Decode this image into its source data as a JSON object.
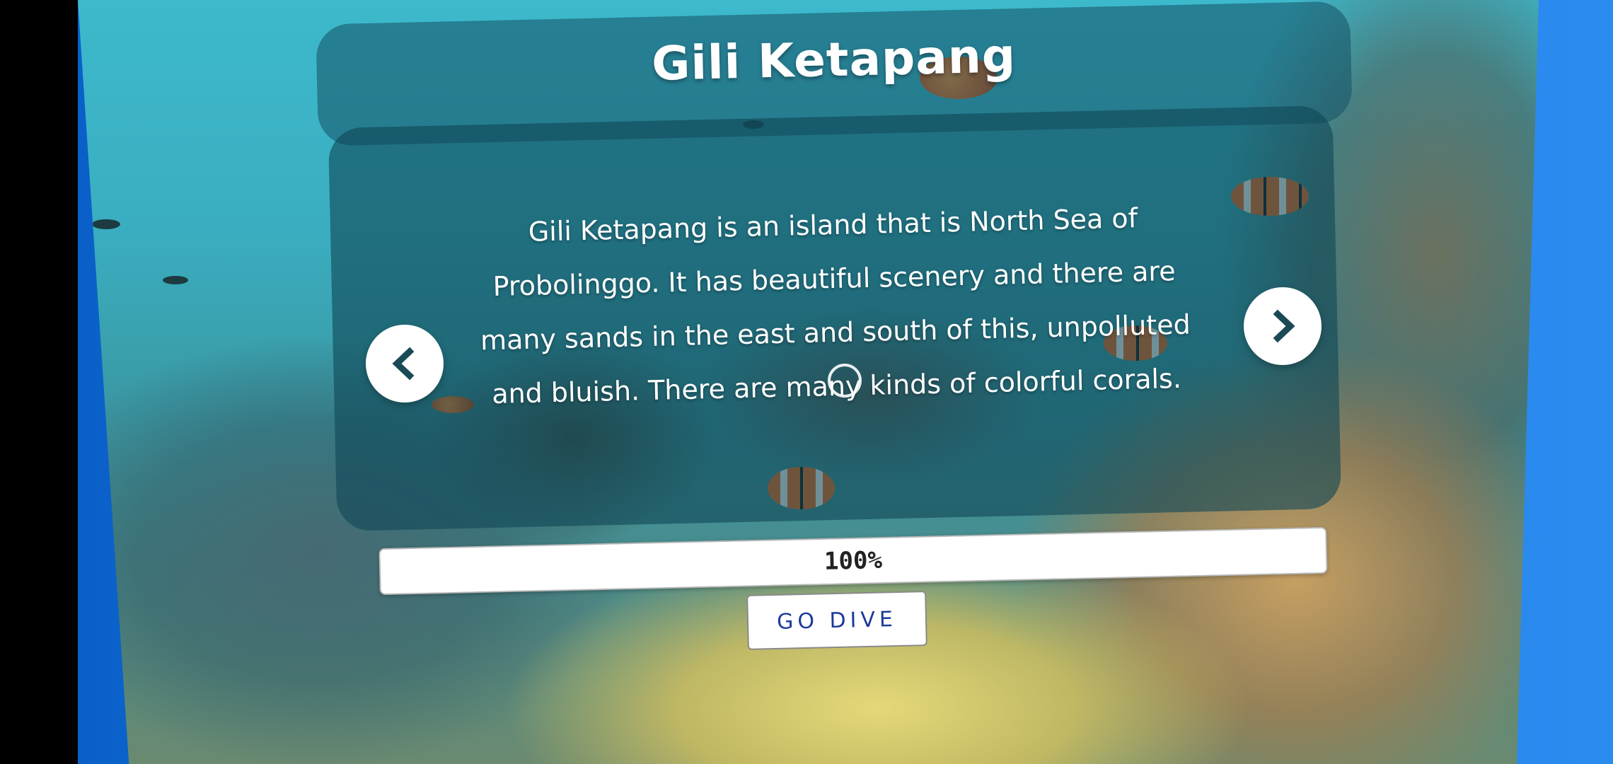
{
  "title": "Gili Ketapang",
  "description": "Gili Ketapang is an island that is North Sea of Probolinggo. It has beautiful scenery and there are many sands in the east and south of this, unpolluted and bluish. There are many kinds of colorful corals.",
  "navigation": {
    "prev_icon": "chevron-left-icon",
    "next_icon": "chevron-right-icon"
  },
  "progress": {
    "label": "100%",
    "value": 1.0
  },
  "dive_button": {
    "label": "GO DIVE"
  },
  "colors": {
    "panel": "#0f4655",
    "dive_text": "#1a3a9a",
    "nav_icon": "#1a4a55",
    "frame_blue": "#1a78e0"
  }
}
